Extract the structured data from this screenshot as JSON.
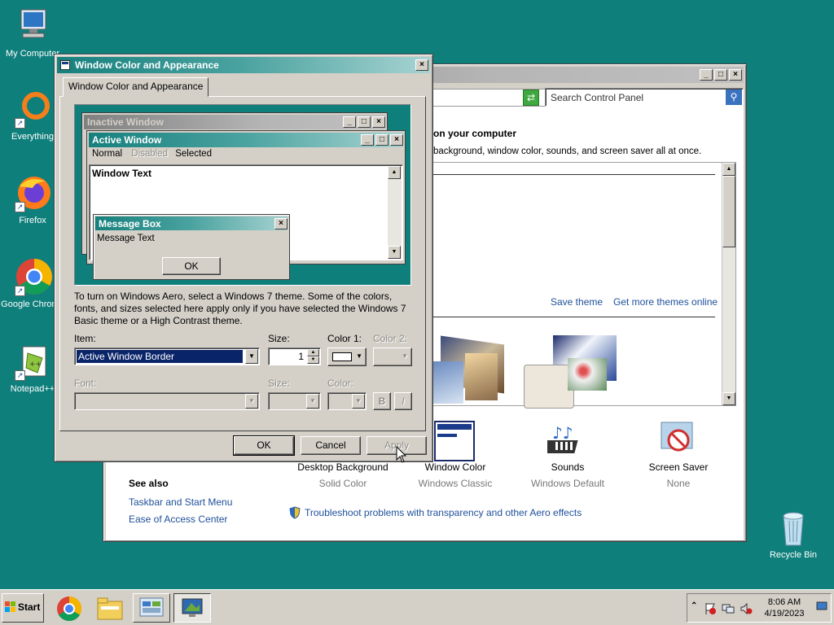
{
  "desktop": {
    "icons": [
      {
        "label": "My Computer",
        "icon": "computer-icon"
      },
      {
        "label": "Everything",
        "icon": "everything-icon"
      },
      {
        "label": "Firefox",
        "icon": "firefox-icon"
      },
      {
        "label": "Google Chrome",
        "icon": "chrome-icon"
      },
      {
        "label": "Notepad++",
        "icon": "notepadpp-icon"
      },
      {
        "label": "Recycle Bin",
        "icon": "recycle-bin-icon"
      }
    ]
  },
  "control_panel": {
    "search_placeholder": "Search Control Panel",
    "heading": "on your computer",
    "subheading": "background, window color, sounds, and screen saver all at once.",
    "save_theme": "Save theme",
    "get_more_themes": "Get more themes online",
    "items": [
      {
        "label": "Desktop Background",
        "sub": "Solid Color"
      },
      {
        "label": "Window Color",
        "sub": "Windows Classic"
      },
      {
        "label": "Sounds",
        "sub": "Windows Default"
      },
      {
        "label": "Screen Saver",
        "sub": "None"
      }
    ],
    "see_also": {
      "title": "See also",
      "links": [
        "Taskbar and Start Menu",
        "Ease of Access Center"
      ]
    },
    "troubleshoot": "Troubleshoot problems with transparency and other Aero effects"
  },
  "dialog": {
    "title": "Window Color and Appearance",
    "tab": "Window Color and Appearance",
    "preview": {
      "inactive_title": "Inactive Window",
      "active_title": "Active Window",
      "menu": [
        "Normal",
        "Disabled",
        "Selected"
      ],
      "window_text": "Window Text",
      "msgbox_title": "Message Box",
      "msgbox_text": "Message Text",
      "msgbox_ok": "OK"
    },
    "info": "To turn on Windows Aero, select a Windows 7 theme.  Some of the colors, fonts, and sizes selected here apply only if you have selected the Windows 7 Basic theme or a High Contrast theme.",
    "item_label": "Item:",
    "item_value": "Active Window Border",
    "size_label": "Size:",
    "size_value": "1",
    "color1_label": "Color 1:",
    "color2_label": "Color 2:",
    "font_label": "Font:",
    "font_size_label": "Size:",
    "font_color_label": "Color:",
    "bold": "B",
    "italic": "I",
    "ok": "OK",
    "cancel": "Cancel",
    "apply": "Apply"
  },
  "taskbar": {
    "start": "Start",
    "time": "8:06 AM",
    "date": "4/19/2023"
  },
  "colors": {
    "desktop": "#0f7f7c",
    "selection": "#0a246a",
    "preview_bg": "#0f7f7c"
  }
}
